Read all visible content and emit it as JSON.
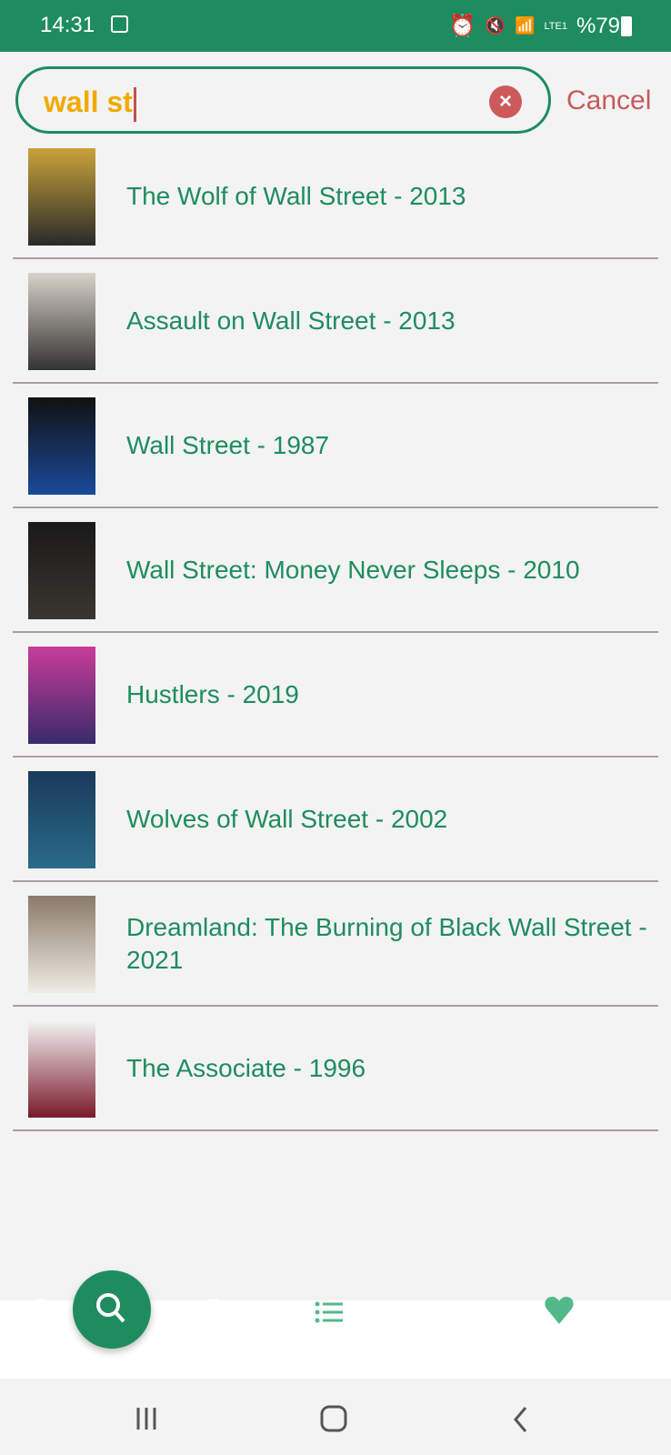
{
  "status": {
    "time": "14:31",
    "battery": "%79",
    "network": "LTE1"
  },
  "search": {
    "value": "wall st",
    "cancel_label": "Cancel"
  },
  "results": [
    {
      "title": "The Wolf of Wall Street - 2013",
      "poster_colors": [
        "#c9a23a",
        "#2a2a2a"
      ]
    },
    {
      "title": "Assault on Wall Street - 2013",
      "poster_colors": [
        "#d8d2c8",
        "#333"
      ]
    },
    {
      "title": "Wall Street - 1987",
      "poster_colors": [
        "#111",
        "#1a4a9a"
      ]
    },
    {
      "title": "Wall Street: Money Never Sleeps - 2010",
      "poster_colors": [
        "#1a1a1a",
        "#3a3530"
      ]
    },
    {
      "title": "Hustlers - 2019",
      "poster_colors": [
        "#c83c9a",
        "#3a2a6a"
      ]
    },
    {
      "title": "Wolves of Wall Street - 2002",
      "poster_colors": [
        "#1a3a5a",
        "#2a6a8a"
      ]
    },
    {
      "title": "Dreamland: The Burning of Black Wall Street - 2021",
      "poster_colors": [
        "#8a7a6a",
        "#f0ece4"
      ]
    },
    {
      "title": "The Associate - 1996",
      "poster_colors": [
        "#f4f4f4",
        "#7a1a2a"
      ]
    }
  ],
  "bottom_nav": {
    "active": "search",
    "colors": {
      "accent": "#1e8c5e",
      "icon": "#52b88a"
    }
  }
}
